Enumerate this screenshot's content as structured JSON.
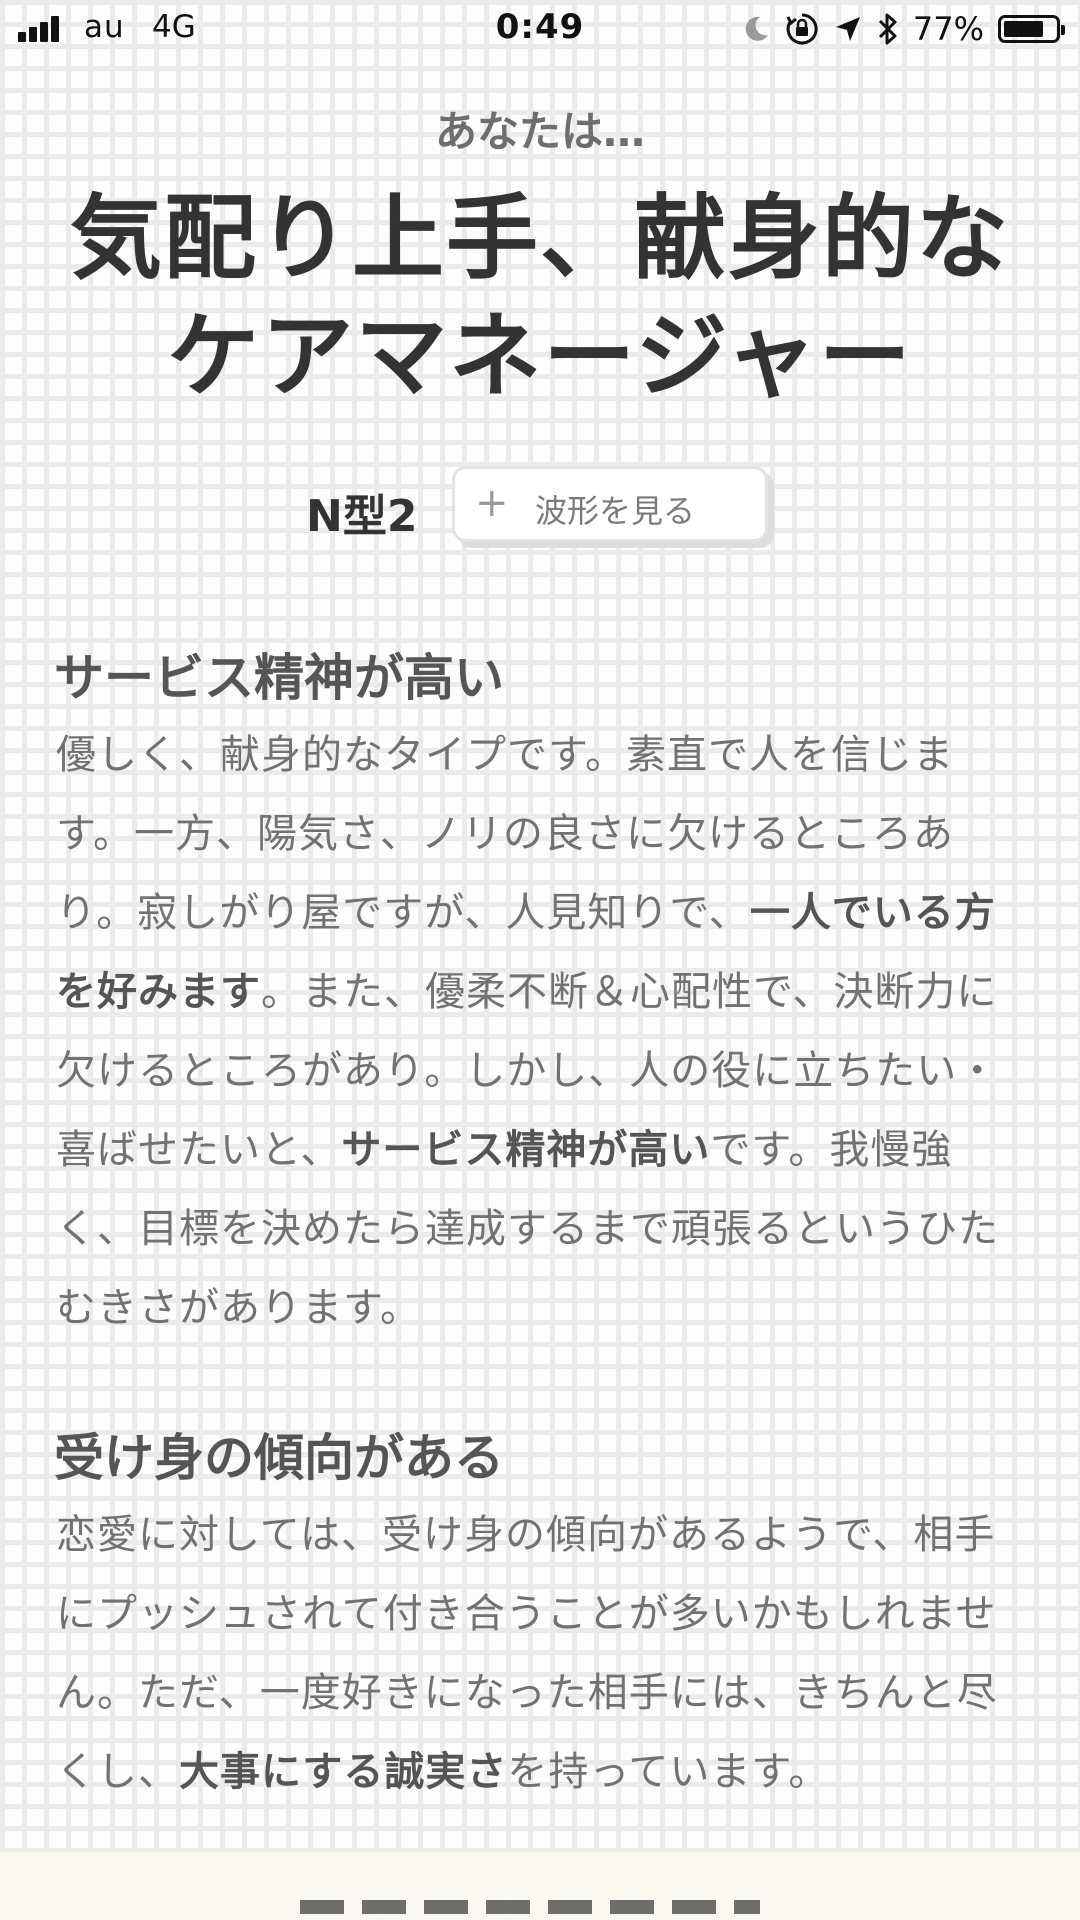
{
  "status_bar": {
    "carrier": "au",
    "network": "4G",
    "time": "0:49",
    "battery_percent": "77%",
    "battery_level": 0.77,
    "icons": [
      "signal-bars-icon",
      "moon-icon",
      "rotation-lock-icon",
      "location-arrow-icon",
      "bluetooth-icon",
      "battery-icon"
    ]
  },
  "result": {
    "intro": "あなたは…",
    "title_line1": "気配り上手、献身的な",
    "title_line2": "ケアマネージャー",
    "type_code": "N型2",
    "wave_button": {
      "icon": "plus-icon",
      "plus": "+",
      "label": "波形を見る"
    }
  },
  "sections": [
    {
      "heading": "サービス精神が高い",
      "body": [
        {
          "text": "優しく、献身的なタイプです。素直で人を信じます。一方、陽気さ、ノリの良さに欠けるところあり。寂しがり屋ですが、人見知りで、",
          "bold": false
        },
        {
          "text": "一人でいる方を好みます",
          "bold": true
        },
        {
          "text": "。また、優柔不断＆心配性で、決断力に欠けるところがあり。しかし、人の役に立ちたい・喜ばせたいと、",
          "bold": false
        },
        {
          "text": "サービス精神が高い",
          "bold": true
        },
        {
          "text": "です。我慢強く、目標を決めたら達成するまで頑張るというひたむきさがあります。",
          "bold": false
        }
      ]
    },
    {
      "heading": "受け身の傾向がある",
      "body": [
        {
          "text": "恋愛に対しては、受け身の傾向があるようで、相手にプッシュされて付き合うことが多いかもしれません。ただ、一度好きになった相手には、きちんと尽くし、",
          "bold": false
        },
        {
          "text": "大事にする誠実さ",
          "bold": true
        },
        {
          "text": "を持っています。",
          "bold": false
        }
      ]
    }
  ],
  "colors": {
    "title": "#333333",
    "body": "#727272",
    "grid": "#ebebeb",
    "footer": "#fbf8f0"
  }
}
